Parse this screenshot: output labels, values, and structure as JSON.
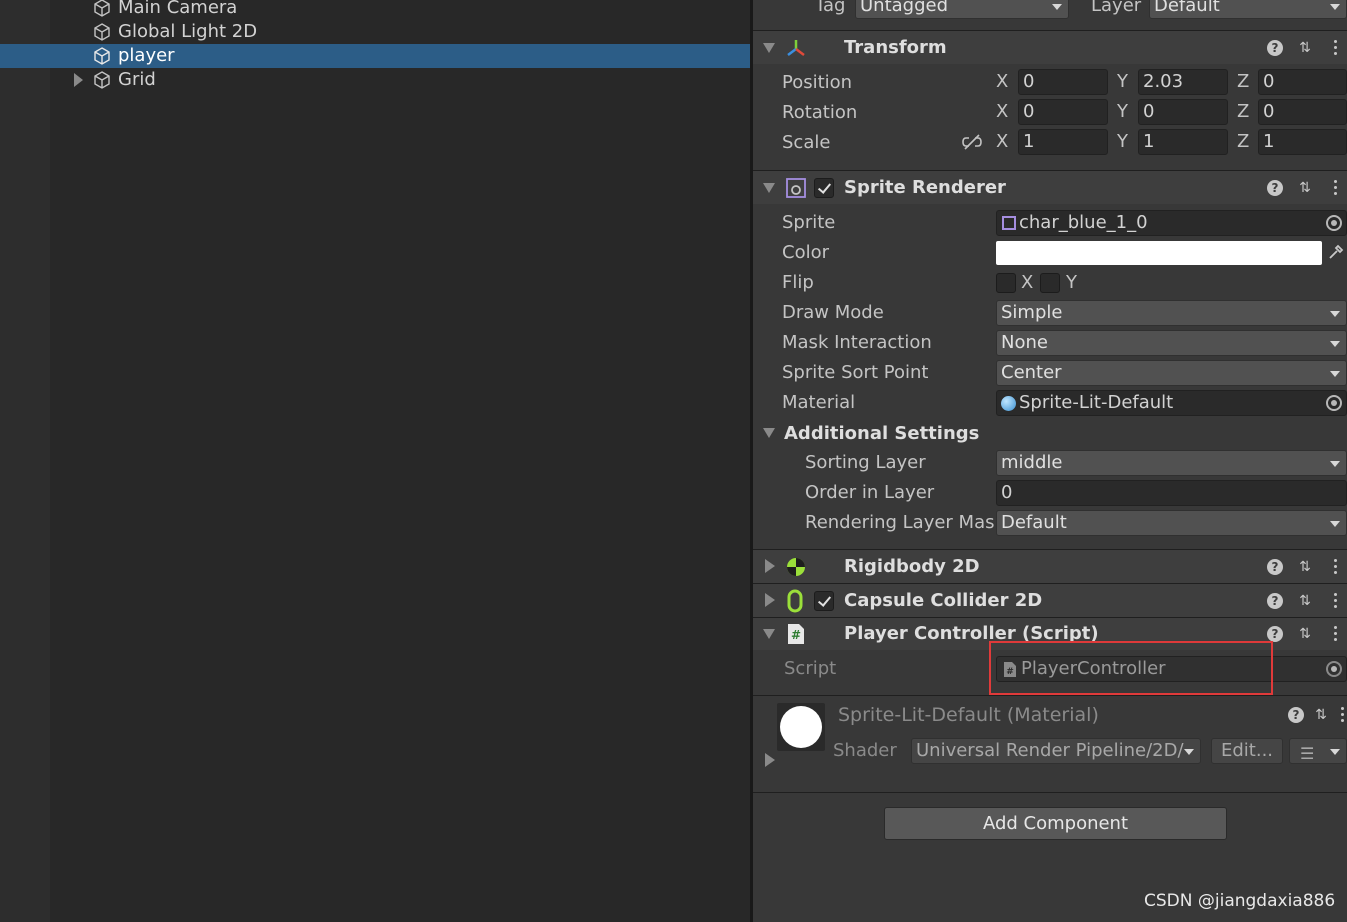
{
  "hierarchy": {
    "items": [
      {
        "label": "Main Camera"
      },
      {
        "label": "Global Light 2D"
      },
      {
        "label": "player"
      },
      {
        "label": "Grid"
      }
    ]
  },
  "inspector": {
    "tag_label": "Tag",
    "tag_value": "Untagged",
    "layer_label": "Layer",
    "layer_value": "Default",
    "transform": {
      "title": "Transform",
      "position_label": "Position",
      "rotation_label": "Rotation",
      "scale_label": "Scale",
      "axis_x": "X",
      "axis_y": "Y",
      "axis_z": "Z",
      "position": {
        "x": "0",
        "y": "2.03",
        "z": "0"
      },
      "rotation": {
        "x": "0",
        "y": "0",
        "z": "0"
      },
      "scale": {
        "x": "1",
        "y": "1",
        "z": "1"
      }
    },
    "sprite_renderer": {
      "title": "Sprite Renderer",
      "sprite_label": "Sprite",
      "sprite_value": "char_blue_1_0",
      "color_label": "Color",
      "color_value": "#ffffff",
      "flip_label": "Flip",
      "flip_x": "X",
      "flip_y": "Y",
      "draw_mode_label": "Draw Mode",
      "draw_mode_value": "Simple",
      "mask_label": "Mask Interaction",
      "mask_value": "None",
      "sort_point_label": "Sprite Sort Point",
      "sort_point_value": "Center",
      "material_label": "Material",
      "material_value": "Sprite-Lit-Default",
      "additional_label": "Additional Settings",
      "sorting_layer_label": "Sorting Layer",
      "sorting_layer_value": "middle",
      "order_label": "Order in Layer",
      "order_value": "0",
      "rendering_mask_label": "Rendering Layer Mas",
      "rendering_mask_value": "Default"
    },
    "rigidbody": {
      "title": "Rigidbody 2D"
    },
    "capsule": {
      "title": "Capsule Collider 2D"
    },
    "player_controller": {
      "title": "Player Controller (Script)",
      "script_label": "Script",
      "script_value": "PlayerController"
    },
    "material_section": {
      "title": "Sprite-Lit-Default (Material)",
      "shader_label": "Shader",
      "shader_value": "Universal Render Pipeline/2D/",
      "edit_label": "Edit..."
    },
    "add_component_label": "Add Component"
  },
  "watermark": "CSDN @jiangdaxia886",
  "colors": {
    "selection": "#2c5d87",
    "highlight_box": "#e03a3a",
    "rigidbody_icon": "#9be03a",
    "capsule_icon": "#9be03a"
  }
}
